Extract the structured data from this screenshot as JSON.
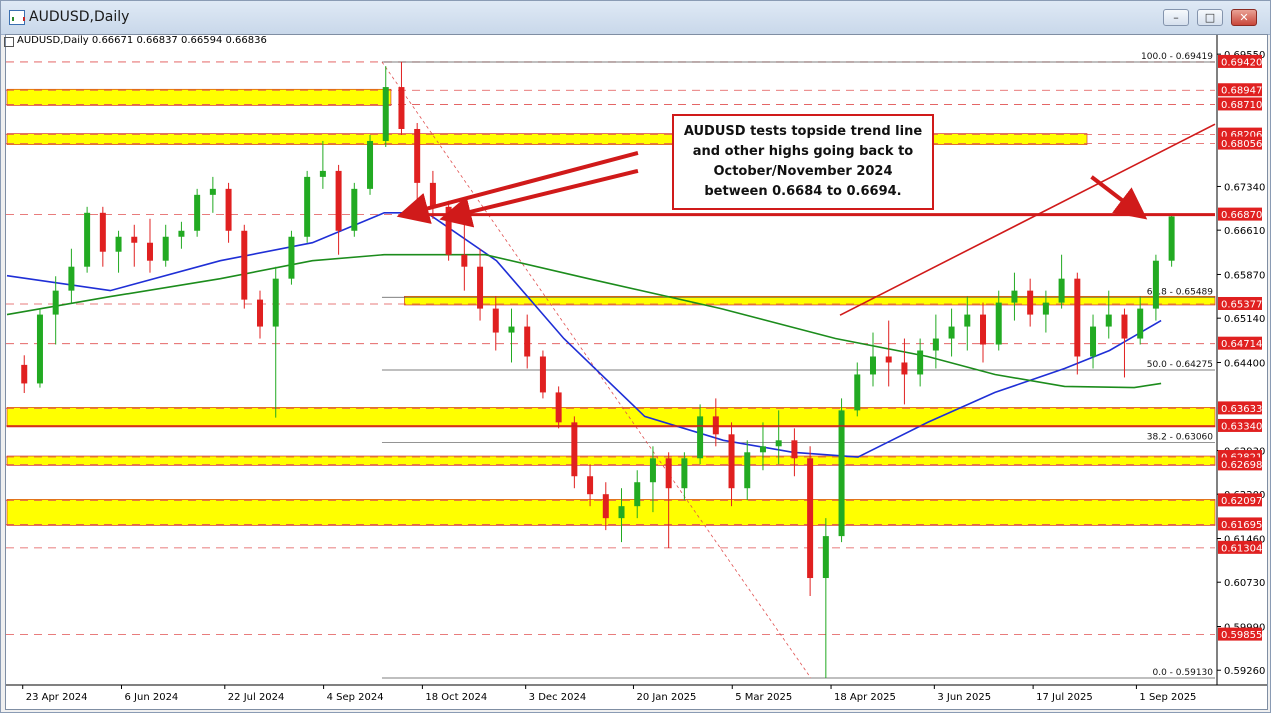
{
  "window": {
    "title": "AUDUSD,Daily",
    "btn_min": "–",
    "btn_max": "□",
    "btn_close": "✕"
  },
  "info": {
    "symbol": "AUDUSD,Daily",
    "ohlc": "0.66671 0.66837 0.66594 0.66836"
  },
  "annotation": {
    "text": "AUDUSD tests topside trend line and other highs going back to October/November 2024 between 0.6684 to 0.6694."
  },
  "colors": {
    "bull": "#22aa22",
    "bear": "#e02020",
    "ma100": "#1f2fd6",
    "ma200": "#1c8c1c",
    "zone": "#ffff00",
    "annotation": "#d01a1a"
  },
  "chart_data": {
    "type": "candlestick",
    "title": "AUDUSD,Daily",
    "ylim": [
      0.5908,
      0.6997
    ],
    "x_dates_range": [
      "2024-04-16",
      "2025-10-06"
    ],
    "grid": false,
    "x_ticks": [
      {
        "date": "2024-04-23",
        "label": "23 Apr 2024"
      },
      {
        "date": "2024-06-06",
        "label": "6 Jun 2024"
      },
      {
        "date": "2024-07-22",
        "label": "22 Jul 2024"
      },
      {
        "date": "2024-09-04",
        "label": "4 Sep 2024"
      },
      {
        "date": "2024-10-18",
        "label": "18 Oct 2024"
      },
      {
        "date": "2024-12-03",
        "label": "3 Dec 2024"
      },
      {
        "date": "2025-01-20",
        "label": "20 Jan 2025"
      },
      {
        "date": "2025-03-05",
        "label": "5 Mar 2025"
      },
      {
        "date": "2025-04-18",
        "label": "18 Apr 2025"
      },
      {
        "date": "2025-06-03",
        "label": "3 Jun 2025"
      },
      {
        "date": "2025-07-17",
        "label": "17 Jul 2025"
      },
      {
        "date": "2025-09-01",
        "label": "1 Sep 2025"
      }
    ],
    "y_ticks": [
      "0.69550",
      "0.67340",
      "0.66610",
      "0.65870",
      "0.65140",
      "0.64400",
      "0.62930",
      "0.62200",
      "0.61460",
      "0.60730",
      "0.59990",
      "0.59260"
    ],
    "price_labels": [
      {
        "v": 0.6942,
        "label": "0.69420"
      },
      {
        "v": 0.68947,
        "label": "0.68947"
      },
      {
        "v": 0.6871,
        "label": "0.68710"
      },
      {
        "v": 0.68206,
        "label": "0.68206"
      },
      {
        "v": 0.68056,
        "label": "0.68056"
      },
      {
        "v": 0.6687,
        "label": "0.66870"
      },
      {
        "v": 0.65377,
        "label": "0.65377"
      },
      {
        "v": 0.64714,
        "label": "0.64714"
      },
      {
        "v": 0.63633,
        "label": "0.63633"
      },
      {
        "v": 0.6334,
        "label": "0.63340"
      },
      {
        "v": 0.62821,
        "label": "0.62821"
      },
      {
        "v": 0.62698,
        "label": "0.62698"
      },
      {
        "v": 0.62097,
        "label": "0.62097"
      },
      {
        "v": 0.61695,
        "label": "0.61695"
      },
      {
        "v": 0.61304,
        "label": "0.61304"
      },
      {
        "v": 0.59855,
        "label": "0.59855"
      }
    ],
    "fib_levels": [
      {
        "label": "100.0 - 0.69419",
        "v": 0.69419
      },
      {
        "label": "61.8 - 0.65489",
        "v": 0.65489
      },
      {
        "label": "50.0 - 0.64275",
        "v": 0.64275
      },
      {
        "label": "38.2 - 0.63060",
        "v": 0.6306
      },
      {
        "label": "0.0 - 0.59130",
        "v": 0.5913
      }
    ],
    "fib_anchor": {
      "high_date": "2024-09-30",
      "high": 0.69419,
      "low_date": "2025-04-09",
      "low": 0.5913
    },
    "zones": [
      {
        "from": 0.68947,
        "to": 0.6871,
        "x_start": "2024-04-16",
        "x_end": "2024-10-04"
      },
      {
        "from": 0.68206,
        "to": 0.68056,
        "x_start": "2024-04-16",
        "x_end": "2025-08-10"
      },
      {
        "from": 0.65489,
        "to": 0.65377,
        "x_start": "2024-10-10",
        "x_end": "2025-10-06"
      },
      {
        "from": 0.63633,
        "to": 0.6334,
        "x_start": "2024-04-16",
        "x_end": "2025-10-06"
      },
      {
        "from": 0.62821,
        "to": 0.62698,
        "x_start": "2024-04-16",
        "x_end": "2025-10-06"
      },
      {
        "from": 0.62097,
        "to": 0.61695,
        "x_start": "2024-04-16",
        "x_end": "2025-10-06"
      }
    ],
    "horizontal_lines": [
      {
        "v": 0.6687,
        "x_start": "2024-10-08",
        "x_end": "2025-10-06",
        "emphasis": "thick"
      },
      {
        "v": 0.6334,
        "x_start": "2024-04-16",
        "x_end": "2025-10-06",
        "emphasis": "normal"
      }
    ],
    "trendline": {
      "from": {
        "date": "2025-04-22",
        "v": 0.6519
      },
      "to": {
        "date": "2025-10-06",
        "v": 0.6838
      }
    },
    "arrows": [
      {
        "from": {
          "date": "2025-01-22",
          "v": 0.679
        },
        "to": {
          "date": "2024-10-10",
          "v": 0.6687
        }
      },
      {
        "from": {
          "date": "2025-01-22",
          "v": 0.676
        },
        "to": {
          "date": "2024-10-29",
          "v": 0.6682
        }
      },
      {
        "from": {
          "date": "2025-08-12",
          "v": 0.675
        },
        "to": {
          "date": "2025-09-03",
          "v": 0.6687
        }
      }
    ],
    "candles": [
      [
        "2024-04-17",
        0.6436,
        0.6452,
        0.6389,
        0.6405
      ],
      [
        "2024-04-24",
        0.6405,
        0.653,
        0.6398,
        0.652
      ],
      [
        "2024-05-01",
        0.652,
        0.6584,
        0.647,
        0.656
      ],
      [
        "2024-05-08",
        0.656,
        0.663,
        0.654,
        0.66
      ],
      [
        "2024-05-15",
        0.66,
        0.67,
        0.659,
        0.669
      ],
      [
        "2024-05-22",
        0.669,
        0.67,
        0.66,
        0.6625
      ],
      [
        "2024-05-29",
        0.6625,
        0.666,
        0.659,
        0.665
      ],
      [
        "2024-06-05",
        0.665,
        0.667,
        0.66,
        0.664
      ],
      [
        "2024-06-12",
        0.664,
        0.668,
        0.659,
        0.661
      ],
      [
        "2024-06-19",
        0.661,
        0.667,
        0.66,
        0.665
      ],
      [
        "2024-06-26",
        0.665,
        0.6675,
        0.663,
        0.666
      ],
      [
        "2024-07-03",
        0.666,
        0.673,
        0.665,
        0.672
      ],
      [
        "2024-07-10",
        0.672,
        0.675,
        0.669,
        0.673
      ],
      [
        "2024-07-17",
        0.673,
        0.674,
        0.664,
        0.666
      ],
      [
        "2024-07-24",
        0.666,
        0.667,
        0.653,
        0.6545
      ],
      [
        "2024-07-31",
        0.6545,
        0.656,
        0.648,
        0.65
      ],
      [
        "2024-08-07",
        0.65,
        0.66,
        0.6348,
        0.658
      ],
      [
        "2024-08-14",
        0.658,
        0.666,
        0.657,
        0.665
      ],
      [
        "2024-08-21",
        0.665,
        0.676,
        0.664,
        0.675
      ],
      [
        "2024-08-28",
        0.675,
        0.681,
        0.673,
        0.676
      ],
      [
        "2024-09-04",
        0.676,
        0.677,
        0.662,
        0.666
      ],
      [
        "2024-09-11",
        0.666,
        0.674,
        0.665,
        0.673
      ],
      [
        "2024-09-18",
        0.673,
        0.682,
        0.672,
        0.681
      ],
      [
        "2024-09-25",
        0.681,
        0.6935,
        0.68,
        0.69
      ],
      [
        "2024-10-02",
        0.69,
        0.6942,
        0.682,
        0.683
      ],
      [
        "2024-10-09",
        0.683,
        0.684,
        0.671,
        0.674
      ],
      [
        "2024-10-16",
        0.674,
        0.676,
        0.668,
        0.67
      ],
      [
        "2024-10-23",
        0.67,
        0.671,
        0.661,
        0.662
      ],
      [
        "2024-10-30",
        0.662,
        0.6687,
        0.656,
        0.66
      ],
      [
        "2024-11-06",
        0.66,
        0.663,
        0.651,
        0.653
      ],
      [
        "2024-11-13",
        0.653,
        0.655,
        0.646,
        0.649
      ],
      [
        "2024-11-20",
        0.649,
        0.653,
        0.644,
        0.65
      ],
      [
        "2024-11-27",
        0.65,
        0.652,
        0.643,
        0.645
      ],
      [
        "2024-12-04",
        0.645,
        0.646,
        0.638,
        0.639
      ],
      [
        "2024-12-11",
        0.639,
        0.64,
        0.633,
        0.634
      ],
      [
        "2024-12-18",
        0.634,
        0.635,
        0.623,
        0.625
      ],
      [
        "2024-12-25",
        0.625,
        0.627,
        0.62,
        0.622
      ],
      [
        "2025-01-01",
        0.622,
        0.624,
        0.616,
        0.618
      ],
      [
        "2025-01-08",
        0.618,
        0.623,
        0.614,
        0.62
      ],
      [
        "2025-01-15",
        0.62,
        0.626,
        0.618,
        0.624
      ],
      [
        "2025-01-22",
        0.624,
        0.63,
        0.619,
        0.628
      ],
      [
        "2025-01-29",
        0.628,
        0.629,
        0.613,
        0.623
      ],
      [
        "2025-02-05",
        0.623,
        0.629,
        0.621,
        0.628
      ],
      [
        "2025-02-12",
        0.628,
        0.637,
        0.627,
        0.635
      ],
      [
        "2025-02-19",
        0.635,
        0.638,
        0.63,
        0.632
      ],
      [
        "2025-02-26",
        0.632,
        0.634,
        0.62,
        0.623
      ],
      [
        "2025-03-05",
        0.623,
        0.631,
        0.621,
        0.629
      ],
      [
        "2025-03-12",
        0.629,
        0.634,
        0.626,
        0.63
      ],
      [
        "2025-03-19",
        0.63,
        0.636,
        0.627,
        0.631
      ],
      [
        "2025-03-26",
        0.631,
        0.633,
        0.625,
        0.628
      ],
      [
        "2025-04-02",
        0.628,
        0.63,
        0.605,
        0.608
      ],
      [
        "2025-04-09",
        0.608,
        0.618,
        0.5913,
        0.615
      ],
      [
        "2025-04-16",
        0.615,
        0.638,
        0.614,
        0.636
      ],
      [
        "2025-04-23",
        0.636,
        0.644,
        0.635,
        0.642
      ],
      [
        "2025-04-30",
        0.642,
        0.649,
        0.64,
        0.645
      ],
      [
        "2025-05-07",
        0.645,
        0.651,
        0.64,
        0.644
      ],
      [
        "2025-05-14",
        0.644,
        0.648,
        0.637,
        0.642
      ],
      [
        "2025-05-21",
        0.642,
        0.648,
        0.64,
        0.646
      ],
      [
        "2025-05-28",
        0.646,
        0.652,
        0.643,
        0.648
      ],
      [
        "2025-06-04",
        0.648,
        0.653,
        0.645,
        0.65
      ],
      [
        "2025-06-11",
        0.65,
        0.655,
        0.646,
        0.652
      ],
      [
        "2025-06-18",
        0.652,
        0.654,
        0.644,
        0.647
      ],
      [
        "2025-06-25",
        0.647,
        0.656,
        0.646,
        0.654
      ],
      [
        "2025-07-02",
        0.654,
        0.659,
        0.651,
        0.656
      ],
      [
        "2025-07-09",
        0.656,
        0.658,
        0.65,
        0.652
      ],
      [
        "2025-07-16",
        0.652,
        0.656,
        0.649,
        0.654
      ],
      [
        "2025-07-23",
        0.654,
        0.662,
        0.653,
        0.658
      ],
      [
        "2025-07-30",
        0.658,
        0.659,
        0.642,
        0.645
      ],
      [
        "2025-08-06",
        0.645,
        0.652,
        0.643,
        0.65
      ],
      [
        "2025-08-13",
        0.65,
        0.656,
        0.648,
        0.652
      ],
      [
        "2025-08-20",
        0.652,
        0.653,
        0.6415,
        0.648
      ],
      [
        "2025-08-27",
        0.648,
        0.655,
        0.647,
        0.653
      ],
      [
        "2025-09-03",
        0.653,
        0.662,
        0.651,
        0.661
      ],
      [
        "2025-09-10",
        0.661,
        0.6687,
        0.66,
        0.6684
      ]
    ],
    "series": [
      {
        "style": "line",
        "points": [
          [
            "2024-04-16",
            0.6585
          ],
          [
            "2024-06-01",
            0.656
          ],
          [
            "2024-07-20",
            0.661
          ],
          [
            "2024-08-30",
            0.664
          ],
          [
            "2024-10-01",
            0.669
          ],
          [
            "2024-10-20",
            0.669
          ],
          [
            "2024-11-20",
            0.661
          ],
          [
            "2024-12-20",
            0.648
          ],
          [
            "2025-01-25",
            0.635
          ],
          [
            "2025-03-01",
            0.631
          ],
          [
            "2025-04-01",
            0.629
          ],
          [
            "2025-04-30",
            0.6282
          ],
          [
            "2025-05-31",
            0.634
          ],
          [
            "2025-06-30",
            0.639
          ],
          [
            "2025-07-31",
            0.643
          ],
          [
            "2025-08-20",
            0.646
          ],
          [
            "2025-09-12",
            0.651
          ]
        ]
      },
      {
        "style": "line",
        "points": [
          [
            "2024-04-16",
            0.652
          ],
          [
            "2024-06-01",
            0.655
          ],
          [
            "2024-07-20",
            0.658
          ],
          [
            "2024-08-30",
            0.661
          ],
          [
            "2024-10-01",
            0.662
          ],
          [
            "2024-11-15",
            0.662
          ],
          [
            "2024-12-31",
            0.658
          ],
          [
            "2025-02-28",
            0.653
          ],
          [
            "2025-04-20",
            0.648
          ],
          [
            "2025-05-31",
            0.645
          ],
          [
            "2025-06-30",
            0.642
          ],
          [
            "2025-07-31",
            0.64
          ],
          [
            "2025-08-31",
            0.6398
          ],
          [
            "2025-09-12",
            0.6405
          ]
        ]
      }
    ]
  }
}
